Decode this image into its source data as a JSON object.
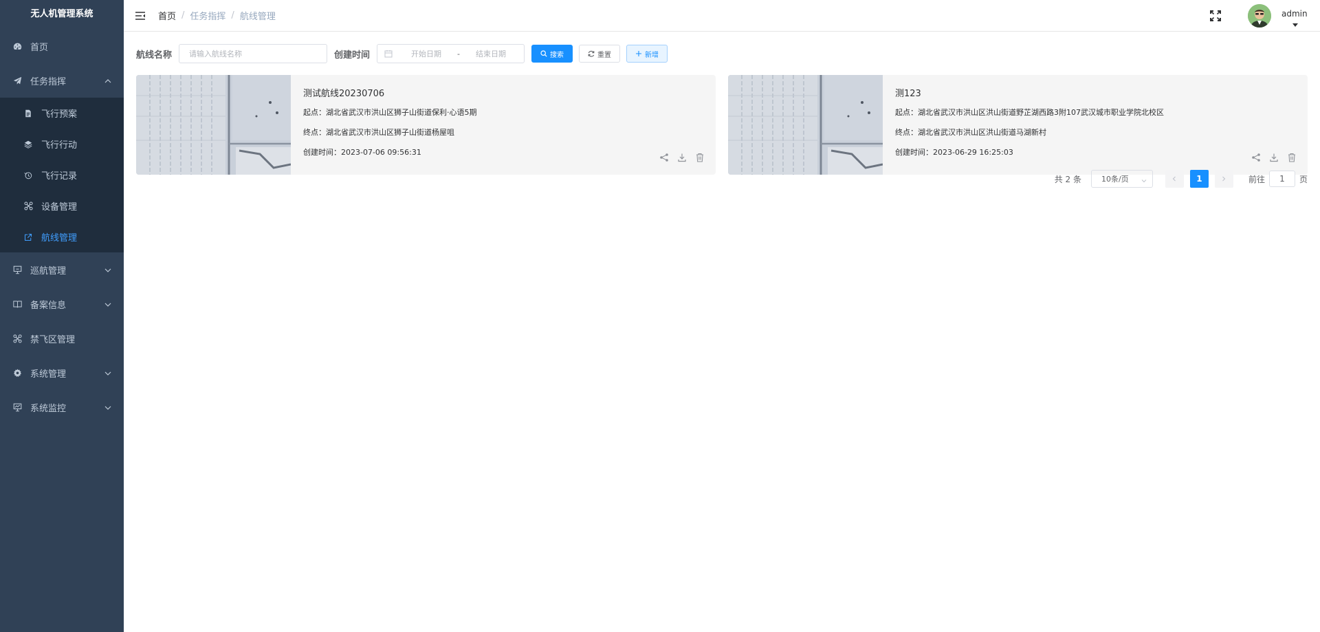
{
  "app": {
    "title": "无人机管理系统"
  },
  "sidebar": {
    "items": [
      {
        "label": "首页",
        "icon": "dashboard-icon"
      },
      {
        "label": "任务指挥",
        "icon": "send-icon",
        "expanded": true,
        "children": [
          {
            "label": "飞行预案",
            "icon": "document-icon"
          },
          {
            "label": "飞行行动",
            "icon": "layers-icon"
          },
          {
            "label": "飞行记录",
            "icon": "history-icon"
          },
          {
            "label": "设备管理",
            "icon": "drone-icon"
          },
          {
            "label": "航线管理",
            "icon": "external-link-icon",
            "active": true
          }
        ]
      },
      {
        "label": "巡航管理",
        "icon": "monitor-icon"
      },
      {
        "label": "备案信息",
        "icon": "book-icon"
      },
      {
        "label": "禁飞区管理",
        "icon": "drone-icon"
      },
      {
        "label": "系统管理",
        "icon": "gear-icon"
      },
      {
        "label": "系统监控",
        "icon": "monitor-chart-icon"
      }
    ]
  },
  "header": {
    "breadcrumb": [
      "首页",
      "任务指挥",
      "航线管理"
    ],
    "username": "admin"
  },
  "filters": {
    "name_label": "航线名称",
    "name_placeholder": "请输入航线名称",
    "time_label": "创建时间",
    "start_placeholder": "开始日期",
    "range_separator": "-",
    "end_placeholder": "结束日期",
    "search_label": "搜索",
    "reset_label": "重置",
    "add_label": "新增"
  },
  "routes": [
    {
      "title": "测试航线20230706",
      "start": "起点：湖北省武汉市洪山区狮子山街道保利·心语5期",
      "end": "终点：湖北省武汉市洪山区狮子山街道杨屋咀",
      "created": "创建时间：2023-07-06 09:56:31"
    },
    {
      "title": "测123",
      "start": "起点：湖北省武汉市洪山区洪山街道野芷湖西路3附107武汉城市职业学院北校区",
      "end": "终点：湖北省武汉市洪山区洪山街道马湖新村",
      "created": "创建时间：2023-06-29 16:25:03"
    }
  ],
  "pagination": {
    "total": "共 2 条",
    "page_size": "10条/页",
    "current_page": "1",
    "goto_label": "前往",
    "goto_value": "1",
    "page_suffix": "页"
  },
  "colors": {
    "sidebar_bg": "#304156",
    "accent": "#1890ff",
    "active_menu": "#409eff"
  }
}
